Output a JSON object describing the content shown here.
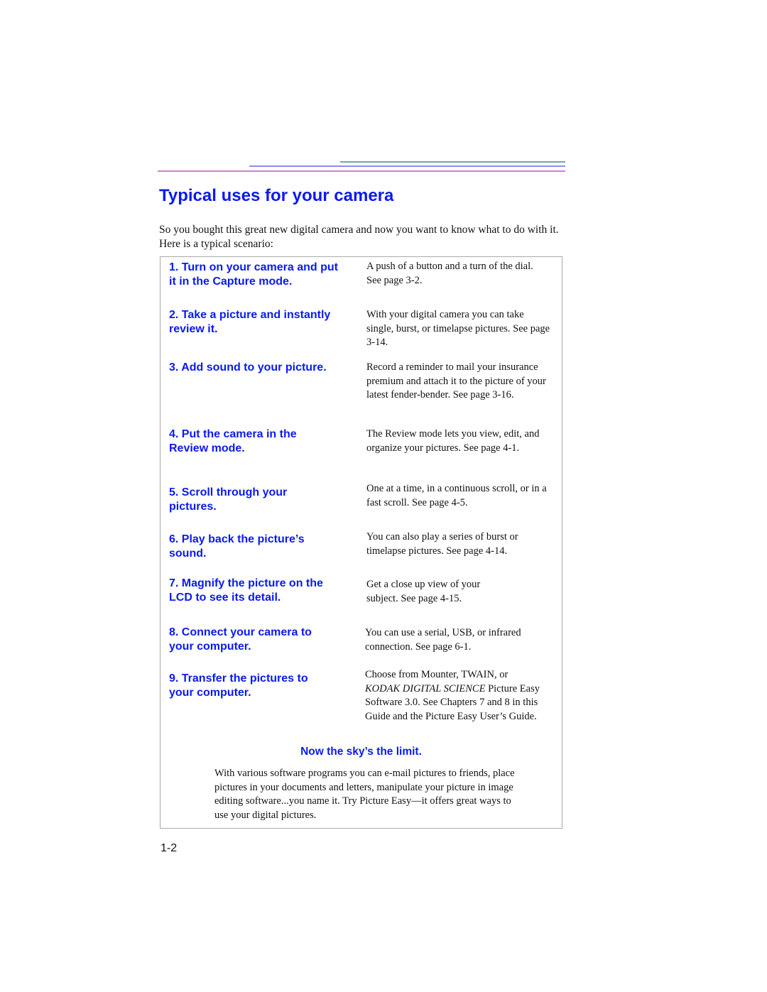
{
  "header": {
    "rule_colors": {
      "teal": "#6fa9a0",
      "blue": "#8b8ef0",
      "pink": "#d27fd2"
    }
  },
  "title": "Typical uses for your camera",
  "intro": "So you bought this great new digital camera and now you want to know what to do with it. Here is a typical scenario:",
  "steps": [
    {
      "title": "1. Turn on your camera and put it in the Capture mode.",
      "description": "A push of a button and a turn of the dial. See page 3-2."
    },
    {
      "title": "2. Take a picture and instantly review it.",
      "description": "With your digital camera you can take single, burst, or timelapse pictures. See page 3-14."
    },
    {
      "title": "3. Add sound to your picture.",
      "description": "Record a reminder to mail your insurance premium and attach it to the picture of your latest fender-bender. See page 3-16."
    },
    {
      "title": "4. Put the camera in the Review mode.",
      "description": "The Review mode lets you view, edit, and organize your pictures. See page 4-1."
    },
    {
      "title": "5. Scroll through your pictures.",
      "description": "One at a time, in a continuous scroll, or in a fast scroll. See page 4-5."
    },
    {
      "title": "6. Play back the picture’s sound.",
      "description": "You can also play a series of burst or timelapse pictures. See page 4-14."
    },
    {
      "title": "7. Magnify the picture on the LCD to see its detail.",
      "description": "Get a close up view of your subject. See page 4-15."
    },
    {
      "title": "8. Connect your camera to your computer.",
      "description": "You can use a serial, USB, or infrared connection. See page 6-1."
    },
    {
      "title": "9. Transfer the pictures to your computer.",
      "description_prefix": "Choose from Mounter, TWAIN, or",
      "description_italic": "KODAK DIGITAL SCIENCE",
      "description_suffix": "Picture Easy Software 3.0. See Chapters 7 and 8 in this Guide and the Picture Easy User’s Guide."
    }
  ],
  "closing": {
    "title": "Now the sky’s the limit.",
    "body": "With various software programs you can e-mail pictures to friends, place pictures in your documents and letters, manipulate your picture in image editing software...you name it. Try Picture Easy—it offers great ways to use your digital pictures."
  },
  "page_number": "1-2",
  "colors": {
    "heading_blue": "#0a1af0",
    "body_text": "#111111",
    "box_border": "#a9a9a9"
  }
}
